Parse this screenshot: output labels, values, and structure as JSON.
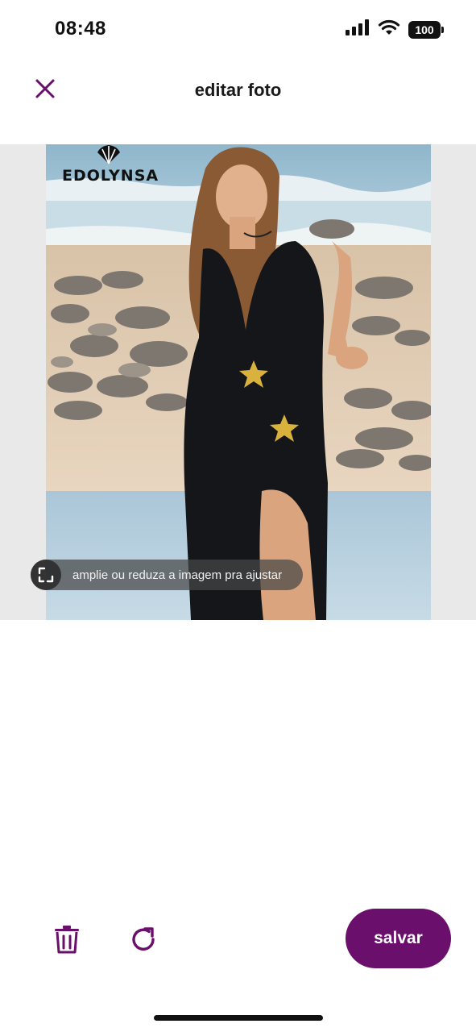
{
  "status_bar": {
    "time": "08:48",
    "battery": "100",
    "signal_icon": "cellular-signal-icon",
    "wifi_icon": "wifi-icon"
  },
  "header": {
    "title": "editar foto",
    "close_icon": "close-icon"
  },
  "photo": {
    "brand": "EDOLYNSA",
    "hint": "amplie ou reduza a imagem pra ajustar",
    "hint_icon": "resize-icon"
  },
  "toolbar": {
    "delete_icon": "trash-icon",
    "rotate_icon": "rotate-icon",
    "save_label": "salvar"
  },
  "colors": {
    "accent": "#6a0f6b",
    "background": "#ffffff",
    "editor_bg": "#e9e9e9"
  }
}
